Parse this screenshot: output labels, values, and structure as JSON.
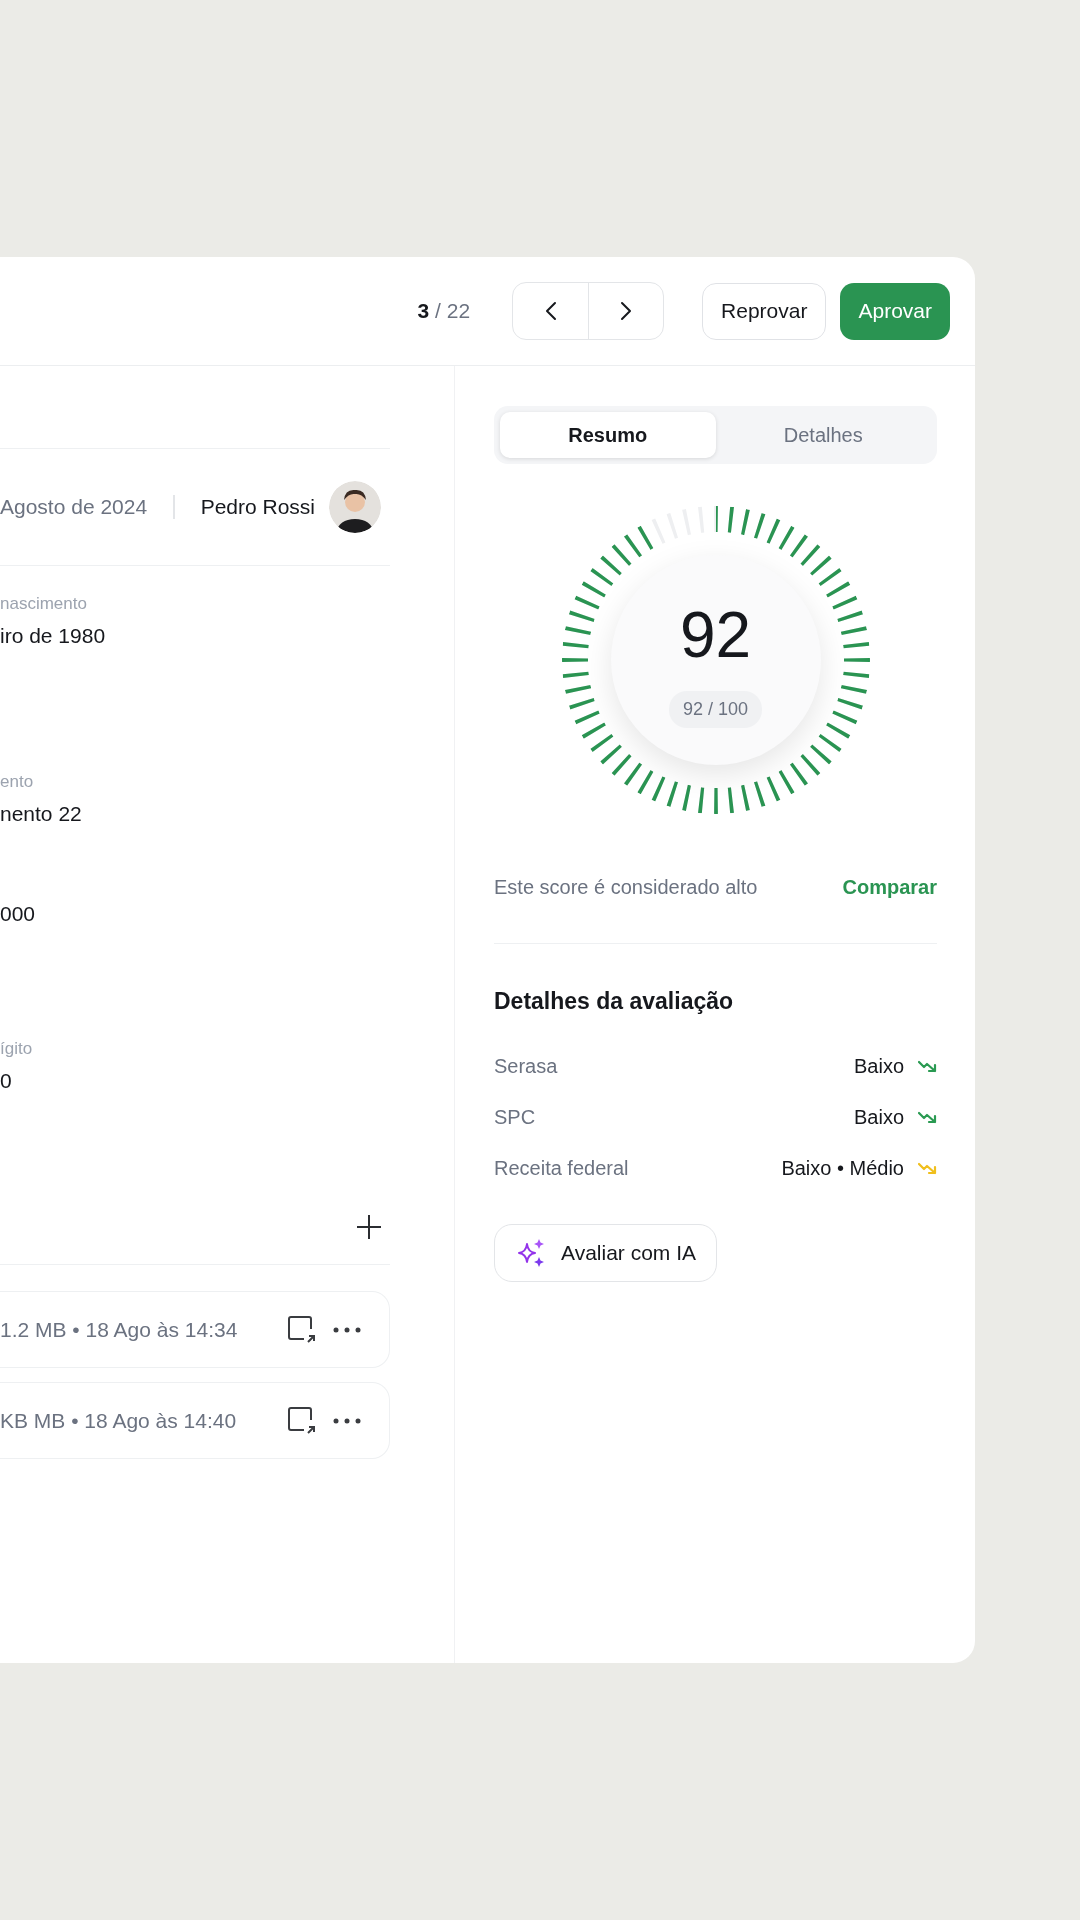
{
  "header": {
    "counter": {
      "current": "3",
      "total": "/ 22"
    },
    "buttons": [
      {
        "label": "Reprovar",
        "kind": "secondary"
      },
      {
        "label": "Aprovar",
        "kind": "primary"
      }
    ]
  },
  "left": {
    "meta": {
      "date": "Agosto de 2024",
      "author": "Pedro Rossi"
    },
    "fields": [
      {
        "label": "nascimento",
        "value": "iro de 1980"
      },
      {
        "label": "ento",
        "value": "nento 22"
      },
      {
        "value": "000"
      },
      {
        "label": "ígito",
        "value": "0"
      }
    ],
    "files": [
      {
        "info": "1.2 MB • 18 Ago às 14:34"
      },
      {
        "info": "KB MB • 18 Ago às 14:40"
      }
    ]
  },
  "right": {
    "tabs": [
      {
        "label": "Resumo",
        "selected": true
      },
      {
        "label": "Detalhes",
        "selected": false
      }
    ],
    "score": {
      "value": "92",
      "badge": "92 / 100",
      "level": 0.92
    },
    "score_note": "Este score é considerado alto",
    "compare_link": "Comparar",
    "details_title": "Detalhes da avaliação",
    "details": [
      {
        "source": "Serasa",
        "rating": "Baixo",
        "color": "#2a9a52"
      },
      {
        "source": "SPC",
        "rating": "Baixo",
        "color": "#2a9a52"
      },
      {
        "source": "Receita federal",
        "rating": "Baixo • Médio",
        "color": "#f0bf1c"
      }
    ],
    "ai_button": "Avaliar com IA"
  }
}
